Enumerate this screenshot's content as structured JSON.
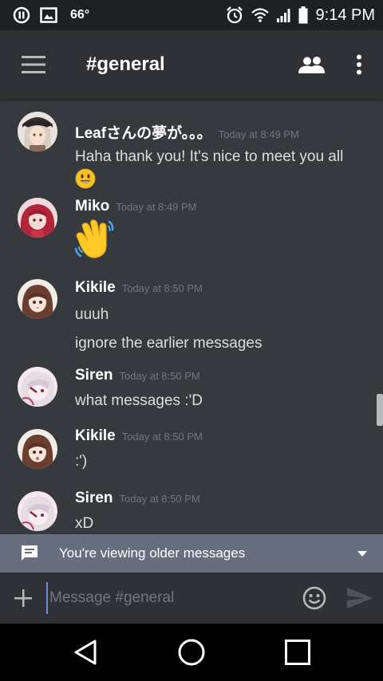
{
  "status_bar": {
    "temperature": "66°",
    "time": "9:14 PM"
  },
  "toolbar": {
    "channel_title": "#general"
  },
  "messages": [
    {
      "author": "Leafさんの夢が。。。",
      "timestamp": "Today at 8:49 PM",
      "lines": [
        "Haha thank you! It's nice to meet you all"
      ],
      "emoji": "smiley"
    },
    {
      "author": "Miko",
      "timestamp": "Today at 8:49 PM",
      "lines": [],
      "emoji": "waving-hand"
    },
    {
      "author": "Kikile",
      "timestamp": "Today at 8:50 PM",
      "lines": [
        "uuuh",
        "ignore the earlier messages"
      ]
    },
    {
      "author": "Siren",
      "timestamp": "Today at 8:50 PM",
      "lines": [
        "what messages :'D"
      ]
    },
    {
      "author": "Kikile",
      "timestamp": "Today at 8:50 PM",
      "lines": [
        ":')"
      ]
    },
    {
      "author": "Siren",
      "timestamp": "Today at 8:50 PM",
      "lines": [
        "xD"
      ]
    }
  ],
  "older_banner": {
    "text": "You're viewing older messages"
  },
  "composer": {
    "placeholder": "Message #general"
  },
  "colors": {
    "background": "#36393e",
    "toolbar": "#2f3136",
    "accent": "#7289da",
    "banner": "#676f7f"
  }
}
